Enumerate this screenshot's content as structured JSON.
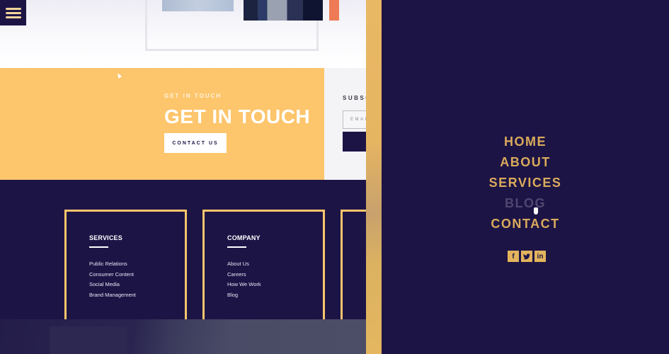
{
  "header": {
    "menu_icon": "hamburger-icon"
  },
  "cta": {
    "eyebrow": "GET IN TOUCH",
    "title": "GET IN TOUCH",
    "button_label": "CONTACT US"
  },
  "subscribe": {
    "label": "SUBSC",
    "email_placeholder": "EMAI"
  },
  "footer": {
    "columns": [
      {
        "title": "SERVICES",
        "links": [
          "Public Relations",
          "Consumer Content",
          "Social Media",
          "Brand Management"
        ]
      },
      {
        "title": "COMPANY",
        "links": [
          "About Us",
          "Careers",
          "How We Work",
          "Blog"
        ]
      }
    ]
  },
  "overlay_menu": {
    "items": [
      "HOME",
      "ABOUT",
      "SERVICES",
      "BLOG",
      "CONTACT"
    ],
    "hovered": "BLOG",
    "social": [
      {
        "icon": "facebook-icon",
        "glyph": "f"
      },
      {
        "icon": "twitter-icon",
        "glyph": "t"
      },
      {
        "icon": "linkedin-icon",
        "glyph": "in"
      }
    ]
  },
  "colors": {
    "navy": "#1d1446",
    "gold": "#fdc56c",
    "menu_gold": "#d9ab5b",
    "menu_hover": "#4f4770"
  }
}
